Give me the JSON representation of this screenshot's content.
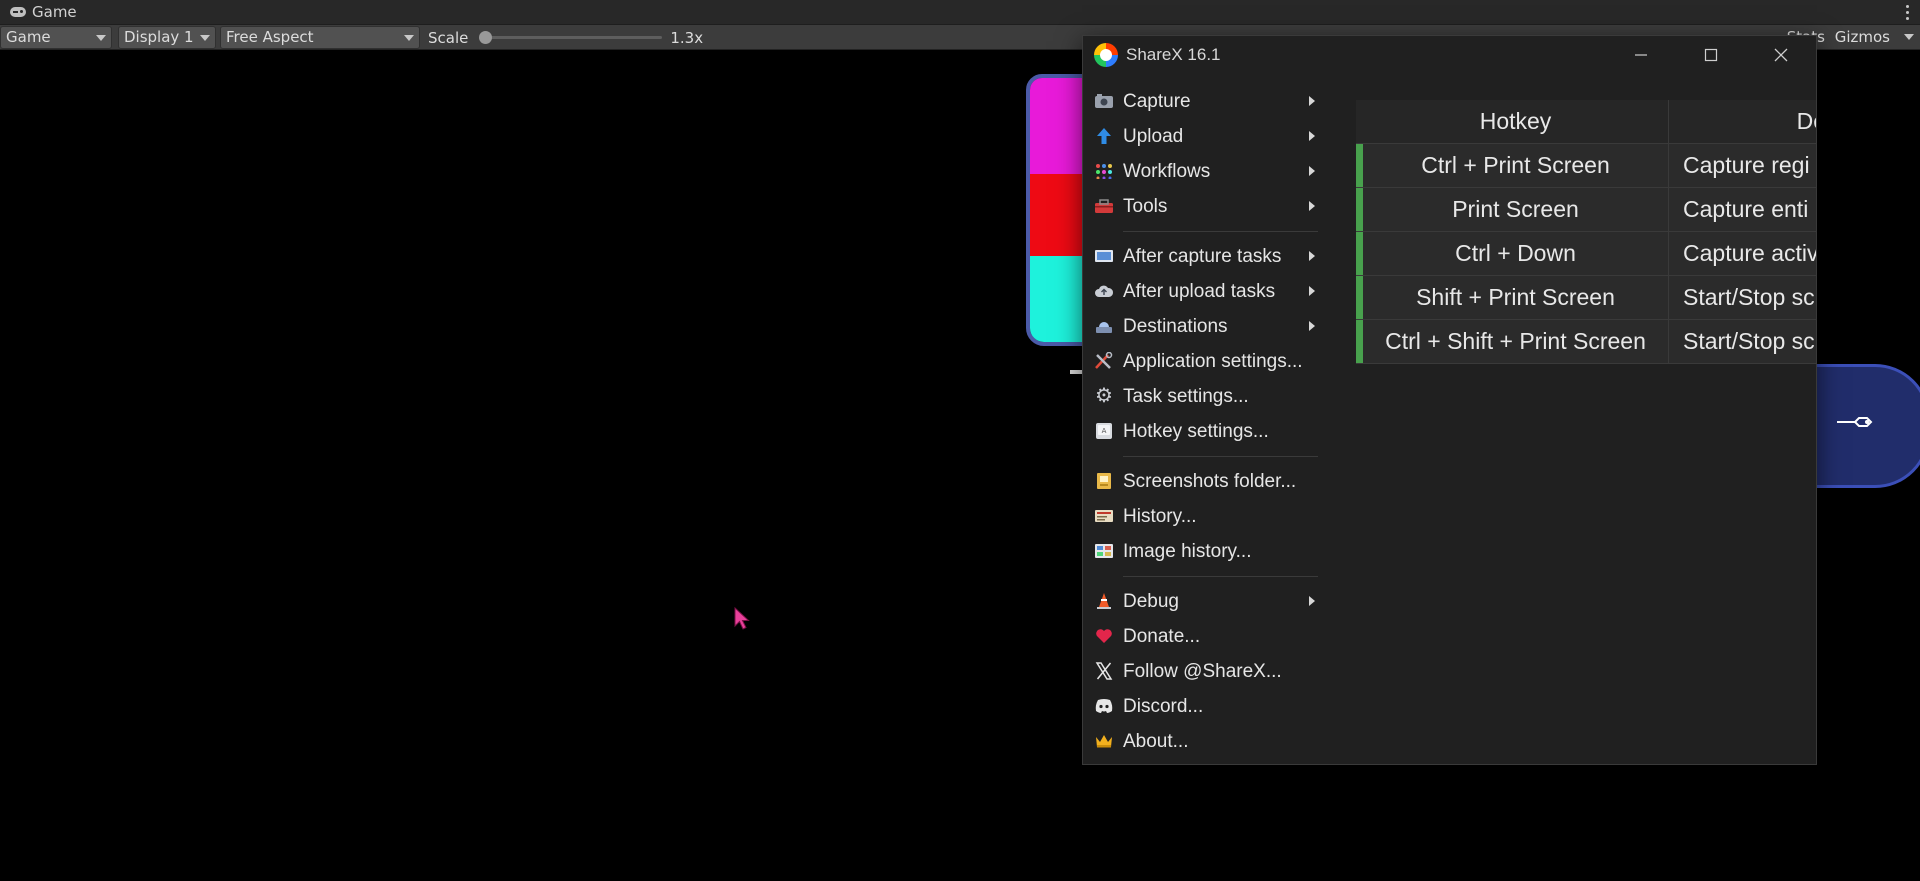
{
  "unity": {
    "tab_title": "Game",
    "toolbar": {
      "view_mode": "Game",
      "display": "Display 1",
      "aspect": "Free Aspect",
      "scale_label": "Scale",
      "scale_value": "1.3x",
      "scale_fraction": 0.0,
      "stats_label": "Stats",
      "gizmos_label": "Gizmos"
    }
  },
  "sharex": {
    "title": "ShareX 16.1",
    "menu": [
      {
        "label": "Capture",
        "icon": "camera-icon",
        "submenu": true
      },
      {
        "label": "Upload",
        "icon": "upload-arrow-icon",
        "submenu": true
      },
      {
        "label": "Workflows",
        "icon": "workflow-grid-icon",
        "submenu": true
      },
      {
        "label": "Tools",
        "icon": "toolbox-icon",
        "submenu": true
      },
      {
        "label": "After capture tasks",
        "icon": "image-task-icon",
        "submenu": true
      },
      {
        "label": "After upload tasks",
        "icon": "cloud-icon",
        "submenu": true
      },
      {
        "label": "Destinations",
        "icon": "destination-icon",
        "submenu": true
      },
      {
        "label": "Application settings...",
        "icon": "wrench-screwdriver-icon",
        "submenu": false
      },
      {
        "label": "Task settings...",
        "icon": "gear-icon",
        "submenu": false
      },
      {
        "label": "Hotkey settings...",
        "icon": "keyboard-key-icon",
        "submenu": false
      },
      {
        "label": "Screenshots folder...",
        "icon": "folder-icon",
        "submenu": false
      },
      {
        "label": "History...",
        "icon": "history-icon",
        "submenu": false
      },
      {
        "label": "Image history...",
        "icon": "image-history-icon",
        "submenu": false
      },
      {
        "label": "Debug",
        "icon": "traffic-cone-icon",
        "submenu": true
      },
      {
        "label": "Donate...",
        "icon": "heart-icon",
        "submenu": false
      },
      {
        "label": "Follow @ShareX...",
        "icon": "x-logo-icon",
        "submenu": false
      },
      {
        "label": "Discord...",
        "icon": "discord-icon",
        "submenu": false
      },
      {
        "label": "About...",
        "icon": "crown-icon",
        "submenu": false
      }
    ],
    "hotkeys": {
      "col_hotkey": "Hotkey",
      "col_description": "De",
      "rows": [
        {
          "hotkey": "Ctrl + Print Screen",
          "description": "Capture regi"
        },
        {
          "hotkey": "Print Screen",
          "description": "Capture enti"
        },
        {
          "hotkey": "Ctrl + Down",
          "description": "Capture activ"
        },
        {
          "hotkey": "Shift + Print Screen",
          "description": "Start/Stop sc"
        },
        {
          "hotkey": "Ctrl + Shift + Print Screen",
          "description": "Start/Stop sc"
        }
      ]
    }
  },
  "colors": {
    "status_active": "#48a14d",
    "cube_magenta": "#e81ad9",
    "cube_red": "#ee0a14",
    "cube_cyan": "#1ef2dc",
    "cursor": "#e8409a"
  }
}
